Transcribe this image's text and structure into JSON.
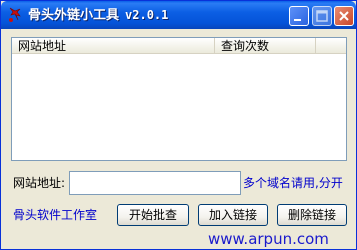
{
  "window": {
    "title": "骨头外链小工具",
    "version": "v2.0.1"
  },
  "listview": {
    "columns": [
      "网站地址",
      "查询次数",
      ""
    ],
    "rows": []
  },
  "form": {
    "url_label": "网站地址:",
    "url_value": "",
    "hint": "多个域名请用,分开"
  },
  "footer": {
    "studio": "骨头软件工作室",
    "start_button": "开始批查",
    "add_button": "加入链接",
    "delete_button": "删除链接"
  },
  "watermark": "www.arpun.com",
  "colors": {
    "titlebar": "#0553d8",
    "hint_text": "#0000cc",
    "window_bg": "#ece9d8"
  }
}
